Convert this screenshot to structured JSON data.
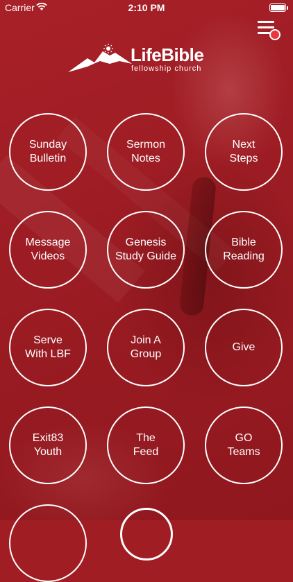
{
  "status_bar": {
    "carrier": "Carrier",
    "time": "2:10 PM"
  },
  "logo": {
    "title": "LifeBible",
    "subtitle": "fellowship church"
  },
  "grid": [
    {
      "line1": "Sunday",
      "line2": "Bulletin"
    },
    {
      "line1": "Sermon",
      "line2": "Notes"
    },
    {
      "line1": "Next",
      "line2": "Steps"
    },
    {
      "line1": "Message",
      "line2": "Videos"
    },
    {
      "line1": "Genesis",
      "line2": "Study Guide"
    },
    {
      "line1": "Bible",
      "line2": "Reading"
    },
    {
      "line1": "Serve",
      "line2": "With LBF"
    },
    {
      "line1": "Join A",
      "line2": "Group"
    },
    {
      "line1": "Give",
      "line2": ""
    },
    {
      "line1": "Exit83",
      "line2": "Youth"
    },
    {
      "line1": "The",
      "line2": "Feed"
    },
    {
      "line1": "GO",
      "line2": "Teams"
    }
  ],
  "colors": {
    "background": "#a11d24",
    "notification_dot": "#e8383f"
  },
  "icons": [
    "wifi-icon",
    "battery-icon",
    "menu-icon",
    "logo-mountain-icon"
  ]
}
